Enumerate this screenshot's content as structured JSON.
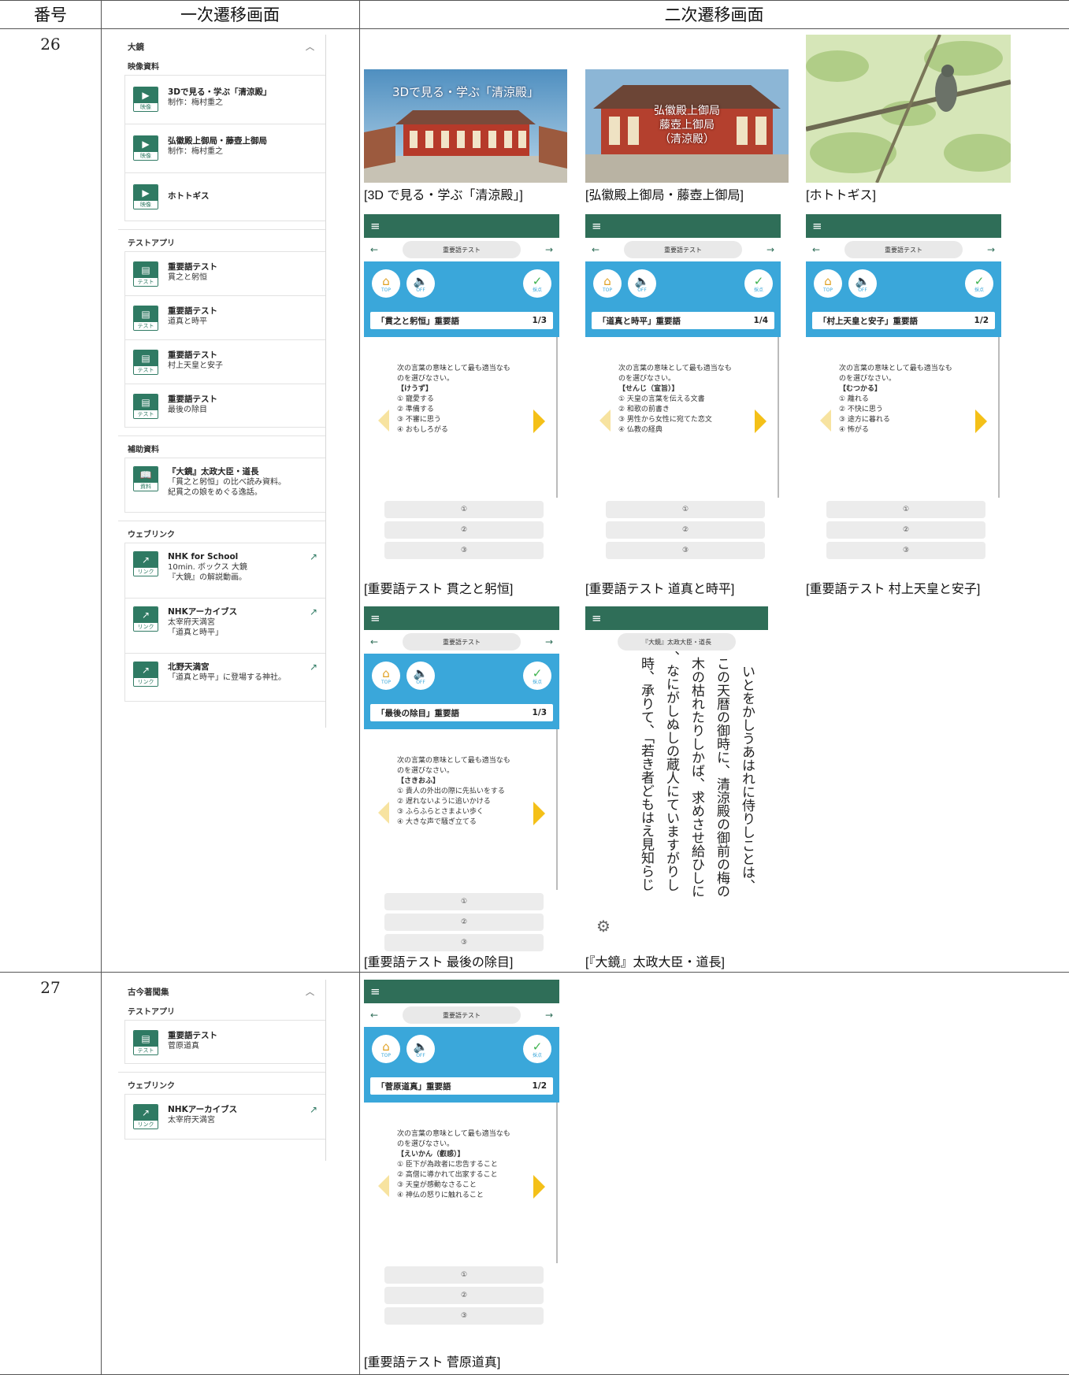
{
  "headers": {
    "number": "番号",
    "primary": "一次遷移画面",
    "secondary": "二次遷移画面"
  },
  "rows": [
    {
      "number": "26"
    },
    {
      "number": "27"
    }
  ],
  "panel26": {
    "title": "大鏡",
    "sections": {
      "video": "映像資料",
      "test": "テストアプリ",
      "supp": "補助資料",
      "web": "ウェブリンク"
    },
    "video_items": [
      {
        "t1": "3Dで見る・学ぶ「清涼殿」",
        "t2": "制作：梅村重之",
        "badge": "映像"
      },
      {
        "t1": "弘徽殿上御局・藤壺上御局",
        "t2": "制作：梅村重之",
        "badge": "映像"
      },
      {
        "t1": "ホトトギス",
        "t2": "",
        "badge": "映像"
      }
    ],
    "test_items": [
      {
        "t1": "重要語テスト",
        "t2": "貫之と躬恒",
        "badge": "テスト"
      },
      {
        "t1": "重要語テスト",
        "t2": "道真と時平",
        "badge": "テスト"
      },
      {
        "t1": "重要語テスト",
        "t2": "村上天皇と安子",
        "badge": "テスト"
      },
      {
        "t1": "重要語テスト",
        "t2": "最後の除目",
        "badge": "テスト"
      }
    ],
    "supp_items": [
      {
        "t1": "『大鏡』太政大臣・道長",
        "t2": "「貫之と躬恒」の比べ読み資料。",
        "t3": "紀貫之の娘をめぐる逸話。",
        "badge": "資料"
      }
    ],
    "web_items": [
      {
        "t1": "NHK for School",
        "t2": "10min. ボックス 大鏡",
        "t3": "『大鏡』の解説動画。",
        "badge": "リンク"
      },
      {
        "t1": "NHKアーカイブス",
        "t2": "太宰府天満宮",
        "t3": "「道真と時平」",
        "badge": "リンク"
      },
      {
        "t1": "北野天満宮",
        "t2": "「道真と時平」に登場する神社。",
        "t3": "",
        "badge": "リンク"
      }
    ]
  },
  "panel27": {
    "title": "古今著聞集",
    "sections": {
      "test": "テストアプリ",
      "web": "ウェブリンク"
    },
    "test_items": [
      {
        "t1": "重要語テスト",
        "t2": "菅原道真",
        "badge": "テスト"
      }
    ],
    "web_items": [
      {
        "t1": "NHKアーカイブス",
        "t2": "太宰府天満宮",
        "badge": "リンク"
      }
    ]
  },
  "images": {
    "seiryoden": {
      "overlay": "3Dで見る・学ぶ「清涼殿」",
      "caption": "[3D で見る・学ぶ「清涼殿」]"
    },
    "tsubone": {
      "overlay1": "弘徽殿上御局",
      "overlay2": "藤壺上御局",
      "overlay3": "（清涼殿）",
      "caption": "[弘徽殿上御局・藤壺上御局]"
    },
    "hototogisu": {
      "caption": "[ホトトギス]"
    }
  },
  "quiz_common": {
    "menu_icon": "≡",
    "pill": "重要語テスト",
    "top": "TOP",
    "off": "OFF",
    "grade": "採点",
    "prompt1": "次の言葉の意味として最も適当なも",
    "prompt2": "のを選びなさい。",
    "opts": [
      "①",
      "②",
      "③"
    ]
  },
  "quizzes": [
    {
      "title": "「貫之と躬恒」重要語",
      "page": "1/3",
      "word": "【けうず】",
      "choices": [
        "① 寵愛する",
        "② 準備する",
        "③ 不審に思う",
        "④ おもしろがる"
      ],
      "caption": "[重要語テスト 貫之と躬恒]"
    },
    {
      "title": "「道真と時平」重要語",
      "page": "1/4",
      "word": "【せんじ（宣旨）】",
      "choices": [
        "① 天皇の言葉を伝える文書",
        "② 和歌の前書き",
        "③ 男性から女性に宛てた恋文",
        "④ 仏教の経典"
      ],
      "caption": "[重要語テスト 道真と時平]"
    },
    {
      "title": "「村上天皇と安子」重要語",
      "page": "1/2",
      "word": "【むつかる】",
      "choices": [
        "① 離れる",
        "② 不快に思う",
        "③ 途方に暮れる",
        "④ 怖がる"
      ],
      "caption": "[重要語テスト 村上天皇と安子]"
    },
    {
      "title": "「最後の除目」重要語",
      "page": "1/3",
      "word": "【さきおふ】",
      "choices": [
        "① 貴人の外出の際に先払いをする",
        "② 遅れないように追いかける",
        "③ ふらふらとさまよい歩く",
        "④ 大きな声で騒ぎ立てる"
      ],
      "caption": "[重要語テスト 最後の除目]"
    },
    {
      "title": "「菅原道真」重要語",
      "page": "1/2",
      "word": "【えいかん（叡感）】",
      "choices": [
        "① 臣下が為政者に忠告すること",
        "② 高僧に導かれて出家すること",
        "③ 天皇が感動なさること",
        "④ 神仏の怒りに触れること"
      ],
      "caption": "[重要語テスト 菅原道真]"
    }
  ],
  "reader": {
    "pill": "『大鏡』太政大臣・道長",
    "lines": [
      "いとをかしうあはれに侍りしことは、",
      "この天暦の御時に、清涼殿の御前の梅の",
      "木の枯れたりしかば、求めさせ給ひしに",
      "、なにがしぬしの蔵人にていますがりし",
      "時、承りて、「若き者どもはえ見知らじ"
    ],
    "caption": "[『大鏡』太政大臣・道長]"
  }
}
